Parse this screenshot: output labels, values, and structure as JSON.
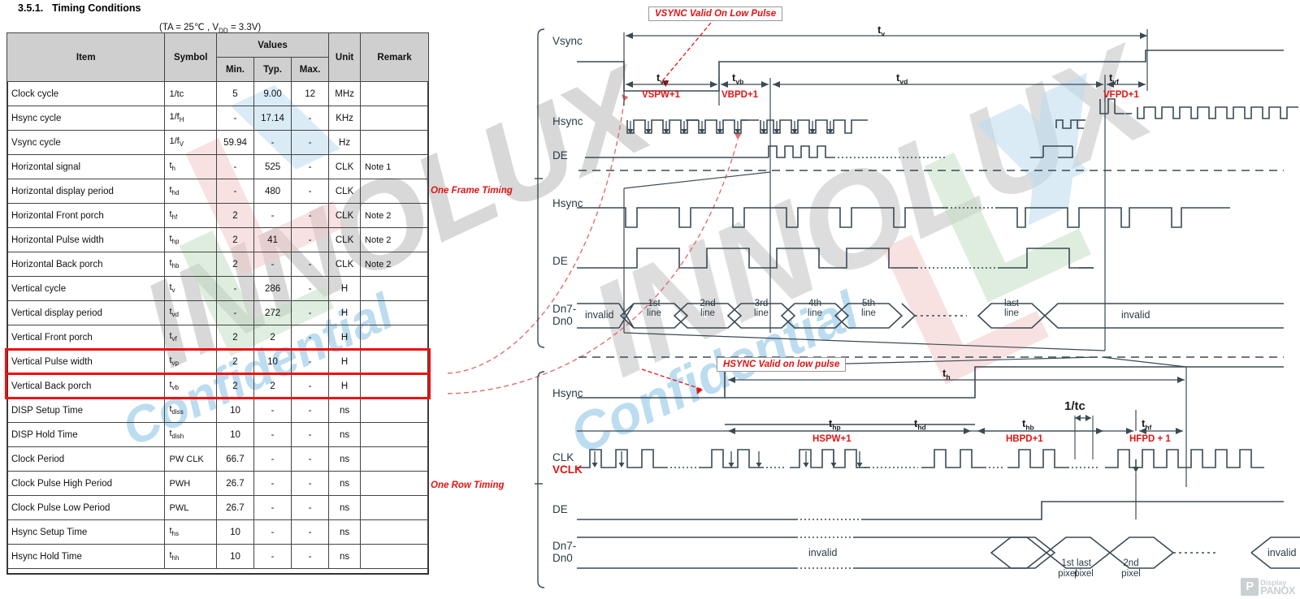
{
  "document": {
    "section_number": "3.5.1.",
    "section_title": "Timing Conditions",
    "condition_note": "(TA = 25℃ , VDD = 3.3V)"
  },
  "table": {
    "headers": {
      "item": "Item",
      "symbol": "Symbol",
      "values": "Values",
      "min": "Min.",
      "typ": "Typ.",
      "max": "Max.",
      "unit": "Unit",
      "remark": "Remark"
    },
    "rows": [
      {
        "item": "Clock cycle",
        "symbol": "1/tc",
        "sub": "",
        "min": "5",
        "typ": "9.00",
        "max": "12",
        "unit": "MHz",
        "remark": "",
        "highlight": false
      },
      {
        "item": "Hsync cycle",
        "symbol": "1/f",
        "sub": "H",
        "min": "-",
        "typ": "17.14",
        "max": "-",
        "unit": "KHz",
        "remark": "",
        "highlight": false
      },
      {
        "item": "Vsync cycle",
        "symbol": "1/f",
        "sub": "V",
        "min": "59.94",
        "typ": "-",
        "max": "-",
        "unit": "Hz",
        "remark": "",
        "highlight": false
      },
      {
        "item": "Horizontal signal",
        "symbol": "t",
        "sub": "h",
        "min": "-",
        "typ": "525",
        "max": "-",
        "unit": "CLK",
        "remark": "Note 1",
        "highlight": false
      },
      {
        "item": "Horizontal display period",
        "symbol": "t",
        "sub": "hd",
        "min": "-",
        "typ": "480",
        "max": "-",
        "unit": "CLK",
        "remark": "",
        "highlight": false
      },
      {
        "item": "Horizontal Front porch",
        "symbol": "t",
        "sub": "hf",
        "min": "2",
        "typ": "-",
        "max": "-",
        "unit": "CLK",
        "remark": "Note 2",
        "highlight": false
      },
      {
        "item": "Horizontal Pulse width",
        "symbol": "t",
        "sub": "hp",
        "min": "2",
        "typ": "41",
        "max": "-",
        "unit": "CLK",
        "remark": "Note 2",
        "highlight": false
      },
      {
        "item": "Horizontal Back porch",
        "symbol": "t",
        "sub": "hb",
        "min": "2",
        "typ": "-",
        "max": "-",
        "unit": "CLK",
        "remark": "Note 2",
        "highlight": false
      },
      {
        "item": "Vertical cycle",
        "symbol": "t",
        "sub": "v",
        "min": "-",
        "typ": "286",
        "max": "-",
        "unit": "H",
        "remark": "",
        "highlight": false
      },
      {
        "item": "Vertical display period",
        "symbol": "t",
        "sub": "vd",
        "min": "-",
        "typ": "272",
        "max": "-",
        "unit": "H",
        "remark": "",
        "highlight": false
      },
      {
        "item": "Vertical Front porch",
        "symbol": "t",
        "sub": "vf",
        "min": "2",
        "typ": "2",
        "max": "-",
        "unit": "H",
        "remark": "",
        "highlight": false
      },
      {
        "item": "Vertical Pulse width",
        "symbol": "t",
        "sub": "vp",
        "min": "2",
        "typ": "10",
        "max": "-",
        "unit": "H",
        "remark": "",
        "highlight": true
      },
      {
        "item": "Vertical Back porch",
        "symbol": "t",
        "sub": "vb",
        "min": "2",
        "typ": "2",
        "max": "-",
        "unit": "H",
        "remark": "",
        "highlight": true
      },
      {
        "item": "DISP Setup Time",
        "symbol": "t",
        "sub": "diss",
        "min": "10",
        "typ": "-",
        "max": "-",
        "unit": "ns",
        "remark": "",
        "highlight": false
      },
      {
        "item": "DISP Hold Time",
        "symbol": "t",
        "sub": "dish",
        "min": "10",
        "typ": "-",
        "max": "-",
        "unit": "ns",
        "remark": "",
        "highlight": false
      },
      {
        "item": "Clock Period",
        "symbol": "PW CLK",
        "sub": "",
        "min": "66.7",
        "typ": "-",
        "max": "-",
        "unit": "ns",
        "remark": "",
        "highlight": false
      },
      {
        "item": "Clock Pulse High Period",
        "symbol": "PWH",
        "sub": "",
        "min": "26.7",
        "typ": "-",
        "max": "-",
        "unit": "ns",
        "remark": "",
        "highlight": false
      },
      {
        "item": "Clock Pulse Low Period",
        "symbol": "PWL",
        "sub": "",
        "min": "26.7",
        "typ": "-",
        "max": "-",
        "unit": "ns",
        "remark": "",
        "highlight": false
      },
      {
        "item": "Hsync Setup Time",
        "symbol": "t",
        "sub": "hs",
        "min": "10",
        "typ": "-",
        "max": "-",
        "unit": "ns",
        "remark": "",
        "highlight": false
      },
      {
        "item": "Hsync Hold Time",
        "symbol": "t",
        "sub": "hh",
        "min": "10",
        "typ": "-",
        "max": "-",
        "unit": "ns",
        "remark": "",
        "highlight": false
      }
    ]
  },
  "diagram": {
    "group_labels": {
      "frame": "One Frame Timing",
      "row": "One Row Timing"
    },
    "callouts": {
      "vsync": "VSYNC Valid On Low Pulse",
      "hsync": "HSYNC Valid on low pulse"
    },
    "frame": {
      "signals": [
        {
          "name": "Vsync"
        },
        {
          "name": "Hsync"
        },
        {
          "name": "DE"
        },
        {
          "name": "Hsync"
        },
        {
          "name": "DE"
        },
        {
          "name": "Dn7-",
          "name2": "Dn0"
        }
      ],
      "timing_marks": [
        {
          "symbol": "t",
          "sub": "v"
        },
        {
          "symbol": "t",
          "sub": "vp"
        },
        {
          "symbol": "t",
          "sub": "vb"
        },
        {
          "symbol": "t",
          "sub": "vd"
        },
        {
          "symbol": "t",
          "sub": "vf"
        }
      ],
      "red_labels": [
        "VSPW+1",
        "VBPD+1",
        "VFPD+1"
      ],
      "data_cells": [
        "invalid",
        "1st line",
        "2nd line",
        "3rd line",
        "4th line",
        "5th line",
        "last line",
        "invalid"
      ]
    },
    "row": {
      "signals": [
        {
          "name": "Hsync"
        },
        {
          "name": "CLK",
          "name2": "VCLK"
        },
        {
          "name": "DE"
        },
        {
          "name": "Dn7-",
          "name2": "Dn0"
        }
      ],
      "timing_marks": [
        {
          "symbol": "t",
          "sub": "h"
        },
        {
          "symbol": "t",
          "sub": "hp"
        },
        {
          "symbol": "t",
          "sub": "hb"
        },
        {
          "symbol": "t",
          "sub": "hd"
        },
        {
          "symbol": "t",
          "sub": "hf"
        }
      ],
      "clock_period_label": "1/tc",
      "red_labels": [
        "HSPW+1",
        "HBPD+1",
        "HFPD + 1"
      ],
      "data_cells": [
        "invalid",
        "1st pixel",
        "2nd pixel",
        "last pixel",
        "invalid"
      ]
    }
  },
  "watermark": {
    "brand": "INNOLUX",
    "confidential": "Confidential"
  },
  "logo": {
    "mark": "P",
    "line1": "Display",
    "line2": "PANOX"
  },
  "colors": {
    "accent_red": "#e11414",
    "highlight_red": "#ee1111",
    "header_gray": "#cfcfcf",
    "wave_stroke": "#3a4a54"
  }
}
